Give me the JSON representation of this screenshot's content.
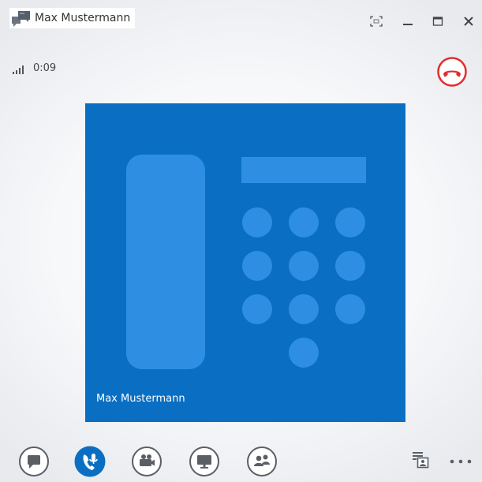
{
  "window": {
    "title": "Max Mustermann",
    "buttons": [
      "fullscreen-icon",
      "minimize-icon",
      "maximize-icon",
      "close-icon"
    ]
  },
  "call": {
    "duration": "0:09",
    "participant_name": "Max Mustermann"
  },
  "toolbar": {
    "items": [
      "chat-icon",
      "microphone-phone-icon",
      "video-camera-icon",
      "screen-share-icon",
      "participants-icon"
    ]
  },
  "colors": {
    "video_background": "#0a6fc2",
    "art_light": "#2e8fe2",
    "accent": "#0a6fc2",
    "hangup": "#e22d2d"
  }
}
